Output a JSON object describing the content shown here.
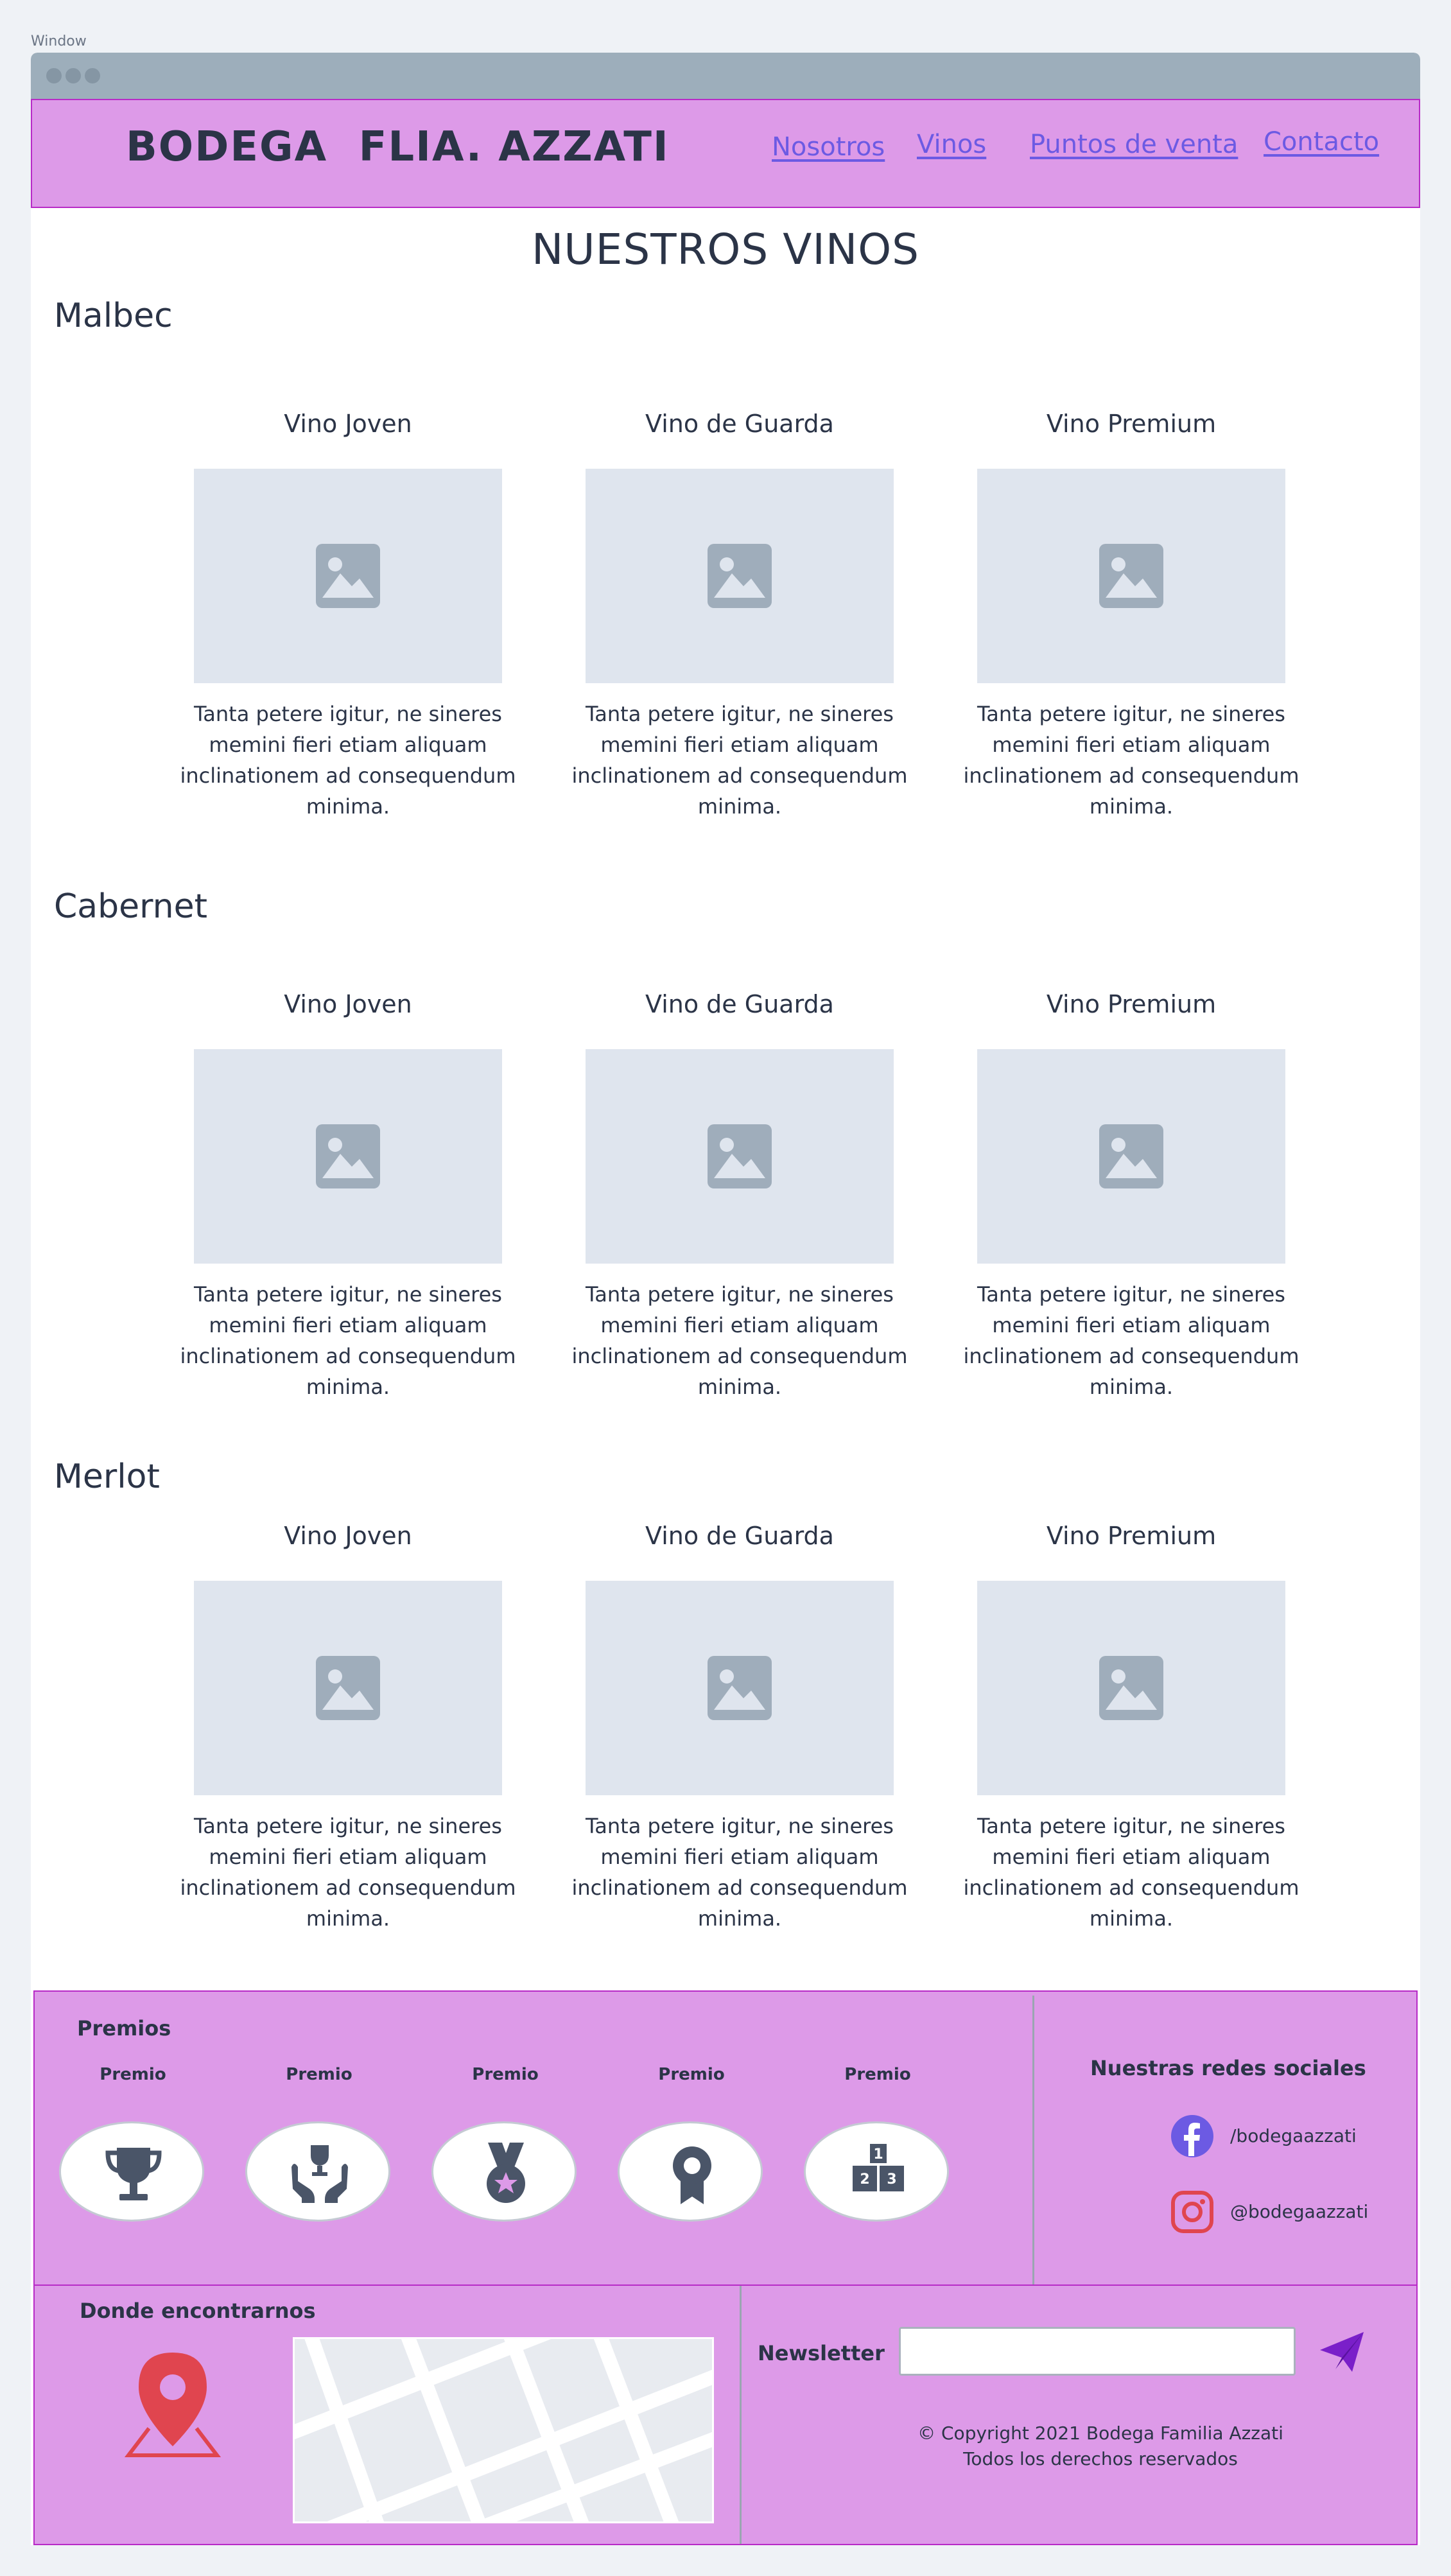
{
  "window": {
    "label": "Window"
  },
  "header": {
    "brand": "BODEGA  FLIA. AZZATI",
    "nav": [
      "Nosotros",
      "Vinos",
      "Puntos de venta",
      "Contacto"
    ]
  },
  "main": {
    "title": "NUESTROS VINOS",
    "sections": [
      {
        "name": "Malbec",
        "cards": [
          {
            "title": "Vino Joven",
            "desc": "Tanta petere igitur, ne sineres memini fieri etiam aliquam inclinationem ad consequendum minima."
          },
          {
            "title": "Vino de Guarda",
            "desc": "Tanta petere igitur, ne sineres memini fieri etiam aliquam inclinationem ad consequendum minima."
          },
          {
            "title": "Vino Premium",
            "desc": "Tanta petere igitur, ne sineres memini fieri etiam aliquam inclinationem ad consequendum minima."
          }
        ]
      },
      {
        "name": "Cabernet",
        "cards": [
          {
            "title": "Vino Joven",
            "desc": "Tanta petere igitur, ne sineres memini fieri etiam aliquam inclinationem ad consequendum minima."
          },
          {
            "title": "Vino de Guarda",
            "desc": "Tanta petere igitur, ne sineres memini fieri etiam aliquam inclinationem ad consequendum minima."
          },
          {
            "title": "Vino Premium",
            "desc": "Tanta petere igitur, ne sineres memini fieri etiam aliquam inclinationem ad consequendum minima."
          }
        ]
      },
      {
        "name": "Merlot",
        "cards": [
          {
            "title": "Vino Joven",
            "desc": "Tanta petere igitur, ne sineres memini fieri etiam aliquam inclinationem ad consequendum minima."
          },
          {
            "title": "Vino de Guarda",
            "desc": "Tanta petere igitur, ne sineres memini fieri etiam aliquam inclinationem ad consequendum minima."
          },
          {
            "title": "Vino Premium",
            "desc": "Tanta petere igitur, ne sineres memini fieri etiam aliquam inclinationem ad consequendum minima."
          }
        ]
      }
    ]
  },
  "footer": {
    "awards": {
      "title": "Premios",
      "items": [
        {
          "label": "Premio",
          "icon": "trophy-icon"
        },
        {
          "label": "Premio",
          "icon": "award-hands-icon"
        },
        {
          "label": "Premio",
          "icon": "medal-icon"
        },
        {
          "label": "Premio",
          "icon": "ribbon-badge-icon"
        },
        {
          "label": "Premio",
          "icon": "podium-icon"
        }
      ]
    },
    "social": {
      "title": "Nuestras redes sociales",
      "facebook": "/bodegaazzati",
      "instagram": "@bodegaazzati"
    },
    "location": {
      "title": "Donde encontrarnos"
    },
    "newsletter": {
      "label": "Newsletter",
      "placeholder": "",
      "value": ""
    },
    "copyright": {
      "line1": "©  Copyright 2021 Bodega Familia Azzati",
      "line2": "Todos los derechos reservados"
    },
    "colors": {
      "accent": "#dd9ae8",
      "border": "#b82bc7",
      "link": "#6c5ae3",
      "send": "#7a1fc9",
      "pin": "#e0454f"
    }
  }
}
